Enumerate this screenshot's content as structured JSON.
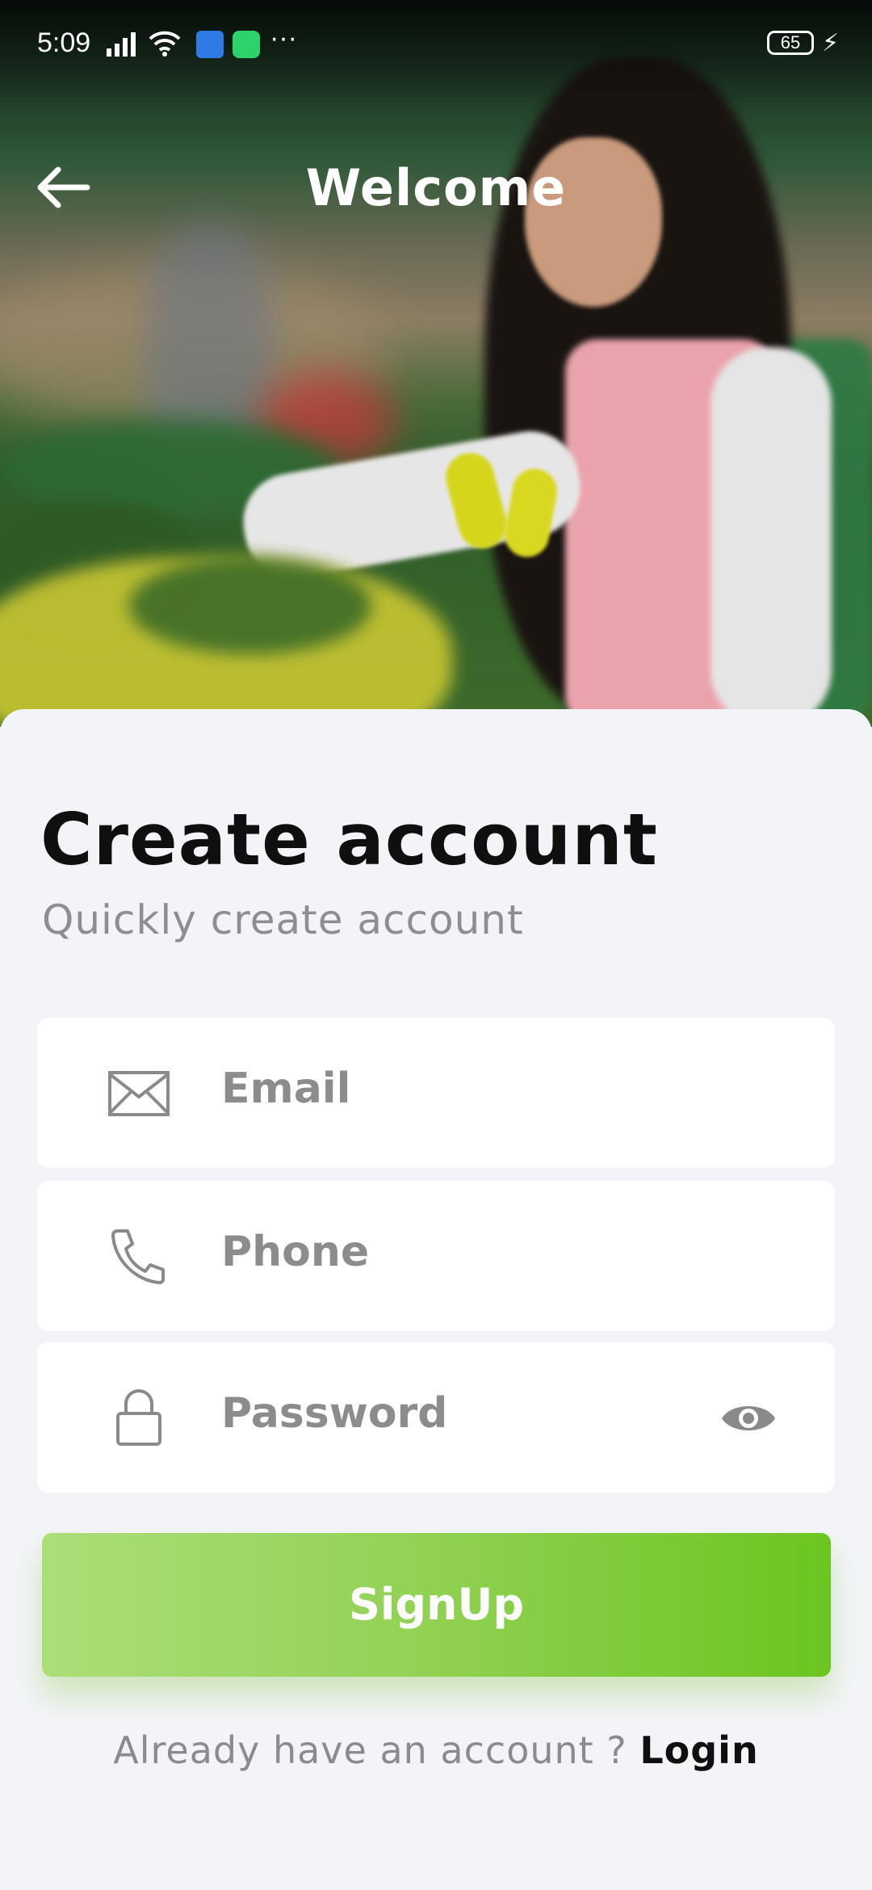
{
  "status_bar": {
    "time": "5:09",
    "battery": "65",
    "overflow": "···",
    "icons": [
      "signal-icon",
      "wifi-icon",
      "app-notification-icon",
      "message-notification-icon",
      "charging-icon"
    ]
  },
  "app_bar": {
    "title": "Welcome",
    "back_icon": "arrow-left-icon"
  },
  "form": {
    "heading": "Create account",
    "subheading": "Quickly create account",
    "email": {
      "placeholder": "Email",
      "icon": "envelope-icon"
    },
    "phone": {
      "placeholder": "Phone",
      "icon": "phone-icon"
    },
    "password": {
      "placeholder": "Password",
      "icon": "lock-icon",
      "toggle_icon": "eye-icon"
    },
    "signup_label": "SignUp",
    "footer_text": "Already have an account ? ",
    "login_label": "Login"
  },
  "colors": {
    "accent_start": "#acde78",
    "accent_end": "#6cc51f",
    "background": "#f3f4f8",
    "heading": "#0f0f10",
    "muted": "#8d8d93"
  }
}
